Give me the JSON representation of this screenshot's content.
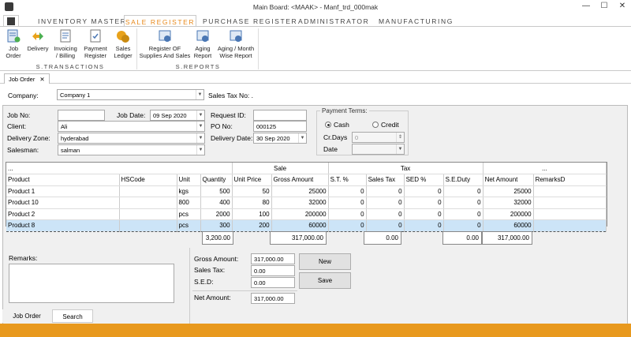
{
  "window": {
    "title": "Main Board: <MAAK> - Manf_trd_000mak",
    "minimize": "—",
    "maximize": "☐",
    "close": "✕"
  },
  "menu_tabs": [
    {
      "label": "INVENTORY MASTER",
      "active": false
    },
    {
      "label": "SALE REGISTER",
      "active": true
    },
    {
      "label": "PURCHASE REGISTER",
      "active": false
    },
    {
      "label": "ADMINISTRATOR",
      "active": false
    },
    {
      "label": "MANUFACTURING",
      "active": false
    }
  ],
  "ribbon": {
    "transactions": [
      {
        "label": "Job\nOrder",
        "icon": "job-order-icon"
      },
      {
        "label": "Delivery",
        "icon": "delivery-icon"
      },
      {
        "label": "Invoicing\n/ Billing",
        "icon": "invoicing-icon"
      },
      {
        "label": "Payment\nRegister",
        "icon": "payment-register-icon"
      },
      {
        "label": "Sales\nLedger",
        "icon": "sales-ledger-icon"
      }
    ],
    "transactions_group": "S.TRANSACTIONS",
    "reports": [
      {
        "label": "Register OF\nSupplies And Sales",
        "icon": "register-icon"
      },
      {
        "label": "Aging\nReport",
        "icon": "aging-report-icon"
      },
      {
        "label": "Aging / Month\nWise Report",
        "icon": "aging-month-icon"
      }
    ],
    "reports_group": "S.REPORTS"
  },
  "doc_tab": {
    "label": "Job Order",
    "close": "✕"
  },
  "form": {
    "company_label": "Company:",
    "company_value": "Company 1",
    "sales_tax_no_label": "Sales Tax No: .",
    "job_no_label": "Job No:",
    "job_no_value": "",
    "job_date_label": "Job Date:",
    "job_date_value": "09 Sep 2020",
    "client_label": "Client:",
    "client_value": "Ali",
    "delivery_zone_label": "Delivery Zone:",
    "delivery_zone_value": "hyderabad",
    "salesman_label": "Salesman:",
    "salesman_value": "salman",
    "request_id_label": "Request ID:",
    "request_id_value": "",
    "po_no_label": "PO No:",
    "po_no_value": "000125",
    "delivery_date_label": "Delivery Date:",
    "delivery_date_value": "30 Sep 2020",
    "payment_terms": {
      "legend": "Payment Terms:",
      "cash": "Cash",
      "credit": "Credit",
      "selected": "Cash",
      "cr_days_label": "Cr.Days",
      "cr_days_value": "0",
      "date_label": "Date",
      "date_value": ""
    }
  },
  "grid": {
    "group_headers": {
      "dots1": "...",
      "sale": "Sale",
      "tax": "Tax",
      "dots2": "..."
    },
    "columns": [
      "Product",
      "HSCode",
      "Unit",
      "Quantity",
      "Unit Price",
      "Gross Amount",
      "S.T. %",
      "Sales Tax",
      "SED %",
      "S.E.Duty",
      "Net Amount",
      "RemarksD"
    ],
    "rows": [
      {
        "product": "Product 1",
        "hscode": "",
        "unit": "kgs",
        "quantity": "500",
        "unit_price": "50",
        "gross": "25000",
        "st_pct": "0",
        "sales_tax": "0",
        "sed_pct": "0",
        "se_duty": "0",
        "net": "25000",
        "remarks": "",
        "selected": false
      },
      {
        "product": "Product 10",
        "hscode": "",
        "unit": "800",
        "quantity": "400",
        "unit_price": "80",
        "gross": "32000",
        "st_pct": "0",
        "sales_tax": "0",
        "sed_pct": "0",
        "se_duty": "0",
        "net": "32000",
        "remarks": "",
        "selected": false
      },
      {
        "product": "Product 2",
        "hscode": "",
        "unit": "pcs",
        "quantity": "2000",
        "unit_price": "100",
        "gross": "200000",
        "st_pct": "0",
        "sales_tax": "0",
        "sed_pct": "0",
        "se_duty": "0",
        "net": "200000",
        "remarks": "",
        "selected": false
      },
      {
        "product": "Product 8",
        "hscode": "",
        "unit": "pcs",
        "quantity": "300",
        "unit_price": "200",
        "gross": "60000",
        "st_pct": "0",
        "sales_tax": "0",
        "sed_pct": "0",
        "se_duty": "0",
        "net": "60000",
        "remarks": "",
        "selected": true
      }
    ],
    "totals": {
      "quantity": "3,200.00",
      "gross": "317,000.00",
      "sales_tax": "0.00",
      "se_duty": "0.00",
      "net": "317,000.00"
    }
  },
  "remarks_label": "Remarks:",
  "summary": {
    "gross_label": "Gross Amount:",
    "gross_value": "317,000.00",
    "sales_tax_label": "Sales Tax:",
    "sales_tax_value": "0.00",
    "sed_label": "S.E.D:",
    "sed_value": "0.00",
    "net_label": "Net Amount:",
    "net_value": "317,000.00"
  },
  "buttons": {
    "new": "New",
    "save": "Save"
  },
  "bottom_tabs": [
    {
      "label": "Job Order",
      "active": true
    },
    {
      "label": "Search",
      "active": false
    }
  ],
  "colors": {
    "accent": "#e8891a",
    "status_bar": "#e8991e",
    "selected_row": "#cce4f7"
  }
}
